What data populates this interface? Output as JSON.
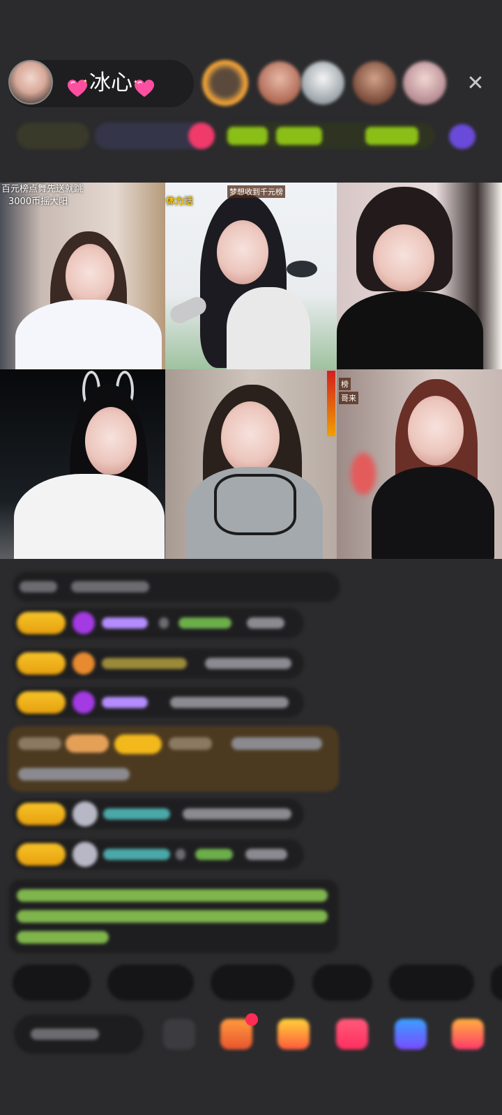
{
  "header": {
    "host_name": "冰心"
  },
  "videos": {
    "cam1_caption_line1": "百元榜点舞先送就跳",
    "cam1_caption_line2": "3000币摇大阳",
    "cam2_corner_label": "体力活",
    "cam2_top_tag": "梦想收到千元榜",
    "cam6_tag_top": "榜",
    "cam6_tag_bottom": "哥来"
  },
  "colors": {
    "background": "#2b2b2d",
    "badge_gold": "#f2b81c",
    "chat_username_purple": "#b48cff",
    "chat_green": "#8fcf5a",
    "chat_cyan": "#5ad1d1"
  }
}
